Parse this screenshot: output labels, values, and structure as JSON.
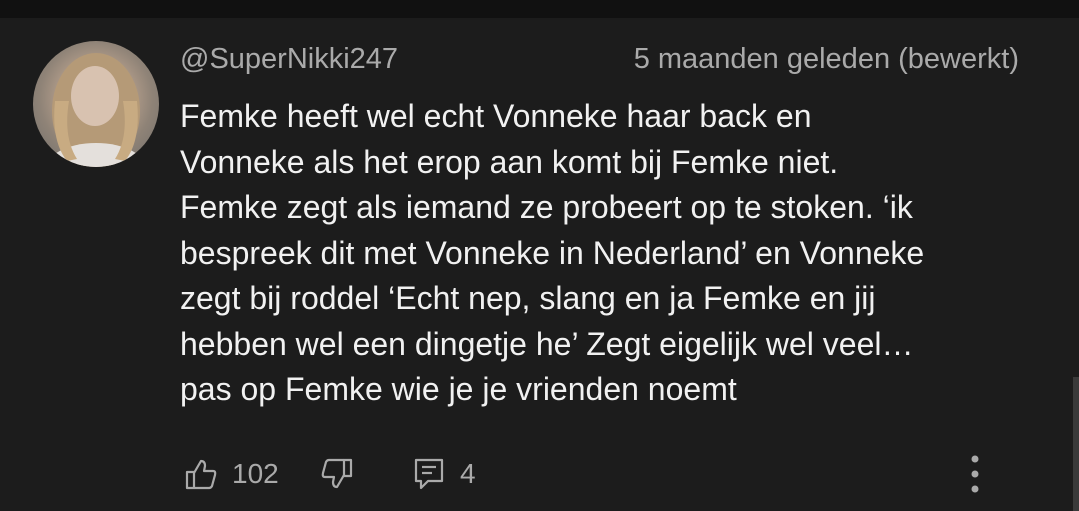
{
  "comment": {
    "author": "@SuperNikki247",
    "timestamp": "5 maanden geleden (bewerkt)",
    "text_lines": [
      "Femke heeft wel echt Vonneke haar back en",
      "Vonneke als het erop aan komt bij Femke niet.",
      "Femke zegt als iemand ze probeert op te stoken. ‘ik",
      "bespreek dit met Vonneke in Nederland’ en Vonneke",
      "zegt bij roddel ‘Echt nep, slang en ja Femke en jij",
      "hebben wel een dingetje he’ Zegt eigelijk wel veel…",
      "pas op Femke wie je je vrienden noemt"
    ],
    "likes": "102",
    "replies": "4"
  },
  "icons": {
    "like": "thumbs-up-icon",
    "dislike": "thumbs-down-icon",
    "reply": "reply-comment-icon",
    "more": "more-vertical-icon"
  },
  "colors": {
    "background": "#1c1c1c",
    "text_primary": "#f1f1f1",
    "text_secondary": "#aaaaaa"
  }
}
